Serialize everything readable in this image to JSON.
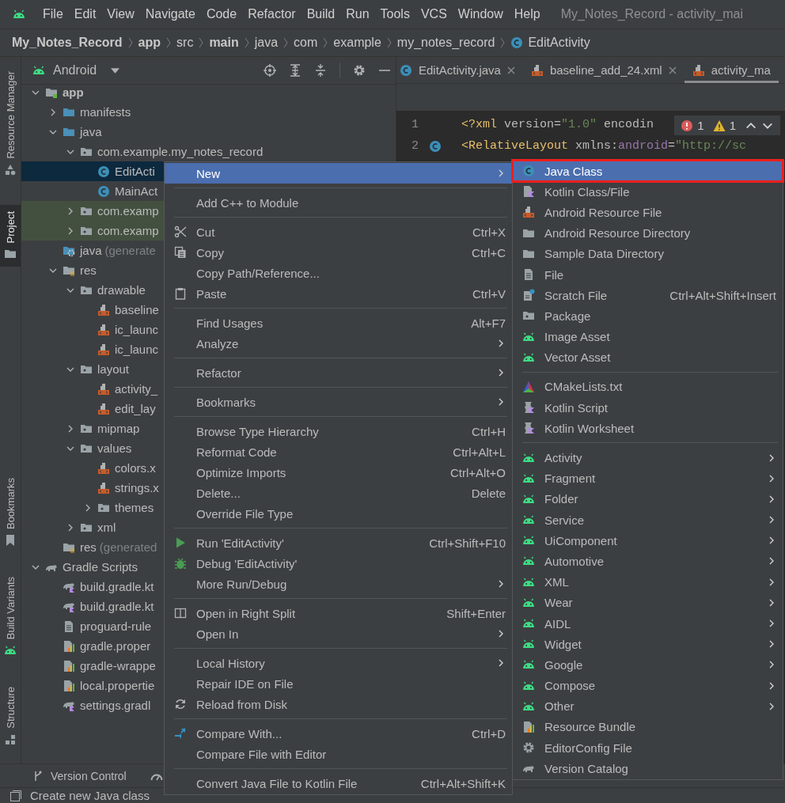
{
  "menubar": {
    "items": [
      {
        "label": "File"
      },
      {
        "label": "Edit"
      },
      {
        "label": "View"
      },
      {
        "label": "Navigate"
      },
      {
        "label": "Code"
      },
      {
        "label": "Refactor"
      },
      {
        "label": "Build"
      },
      {
        "label": "Run"
      },
      {
        "label": "Tools"
      },
      {
        "label": "VCS"
      },
      {
        "label": "Window"
      },
      {
        "label": "Help"
      }
    ],
    "title": "My_Notes_Record - activity_mai"
  },
  "breadcrumbs": [
    {
      "label": "My_Notes_Record",
      "bold": true
    },
    {
      "label": "app",
      "bold": true
    },
    {
      "label": "src",
      "bold": false
    },
    {
      "label": "main",
      "bold": true
    },
    {
      "label": "java",
      "bold": false
    },
    {
      "label": "com",
      "bold": false
    },
    {
      "label": "example",
      "bold": false
    },
    {
      "label": "my_notes_record",
      "bold": false
    },
    {
      "label": "EditActivity",
      "bold": false,
      "kind": "class"
    }
  ],
  "left_stripe": {
    "top": [
      {
        "label": "Resource Manager",
        "kind": "resources",
        "selected": false
      },
      {
        "label": "Project",
        "kind": "folder",
        "selected": true
      }
    ],
    "bottom": [
      {
        "label": "Bookmarks",
        "kind": "bookmark",
        "selected": false
      },
      {
        "label": "Build Variants",
        "kind": "android",
        "selected": false
      },
      {
        "label": "Structure",
        "kind": "structure",
        "selected": false
      }
    ]
  },
  "project": {
    "view": "Android",
    "tree": [
      {
        "label": "app",
        "kind": "module",
        "selected": false,
        "expanded": true,
        "children": [
          {
            "label": "manifests",
            "kind": "source-folder",
            "selected": false,
            "expanded": false
          },
          {
            "label": "java",
            "kind": "source-folder",
            "selected": false,
            "expanded": true,
            "children": [
              {
                "label": "com.example.my_notes_record",
                "kind": "package",
                "selected": false,
                "expanded": true,
                "children": [
                  {
                    "label": "EditActi",
                    "kind": "class",
                    "selected": true
                  },
                  {
                    "label": "MainAct",
                    "kind": "class",
                    "selected": false
                  }
                ]
              },
              {
                "label": "com.examp",
                "kind": "test-package",
                "selected": false,
                "expanded": false
              },
              {
                "label": "com.examp",
                "kind": "test-package",
                "selected": false,
                "expanded": false
              }
            ]
          },
          {
            "label": "java",
            "note": "(generate",
            "kind": "generated-folder",
            "selected": false
          },
          {
            "label": "res",
            "kind": "res-folder",
            "selected": false,
            "expanded": true,
            "children": [
              {
                "label": "drawable",
                "kind": "package",
                "selected": false,
                "expanded": true,
                "children": [
                  {
                    "label": "baseline",
                    "kind": "xml",
                    "selected": false
                  },
                  {
                    "label": "ic_launc",
                    "kind": "xml",
                    "selected": false
                  },
                  {
                    "label": "ic_launc",
                    "kind": "xml",
                    "selected": false
                  }
                ]
              },
              {
                "label": "layout",
                "kind": "package",
                "selected": false,
                "expanded": true,
                "children": [
                  {
                    "label": "activity_",
                    "kind": "xml",
                    "selected": false
                  },
                  {
                    "label": "edit_lay",
                    "kind": "xml",
                    "selected": false
                  }
                ]
              },
              {
                "label": "mipmap",
                "kind": "package",
                "selected": false,
                "expanded": false
              },
              {
                "label": "values",
                "kind": "package",
                "selected": false,
                "expanded": true,
                "children": [
                  {
                    "label": "colors.x",
                    "kind": "xml",
                    "selected": false
                  },
                  {
                    "label": "strings.x",
                    "kind": "xml",
                    "selected": false
                  },
                  {
                    "label": "themes",
                    "kind": "package",
                    "selected": false,
                    "expanded": false
                  }
                ]
              },
              {
                "label": "xml",
                "kind": "package",
                "selected": false,
                "expanded": false
              }
            ]
          },
          {
            "label": "res",
            "note": "(generated",
            "kind": "res-folder",
            "selected": false
          }
        ]
      },
      {
        "label": "Gradle Scripts",
        "kind": "gradle",
        "selected": false,
        "expanded": true,
        "children": [
          {
            "label": "build.gradle.kt",
            "kind": "gradle-kts",
            "selected": false
          },
          {
            "label": "build.gradle.kt",
            "kind": "gradle-kts",
            "selected": false
          },
          {
            "label": "proguard-rule",
            "kind": "file",
            "selected": false
          },
          {
            "label": "gradle.proper",
            "kind": "props",
            "selected": false
          },
          {
            "label": "gradle-wrappe",
            "kind": "props",
            "selected": false
          },
          {
            "label": "local.propertie",
            "kind": "props",
            "selected": false
          },
          {
            "label": "settings.gradl",
            "kind": "gradle-kts",
            "selected": false
          }
        ]
      }
    ]
  },
  "editor": {
    "tabs": [
      {
        "label": "EditActivity.java",
        "kind": "class",
        "selected": false,
        "closable": true
      },
      {
        "label": "baseline_add_24.xml",
        "kind": "xml",
        "selected": false,
        "closable": true
      },
      {
        "label": "activity_ma",
        "kind": "xml",
        "selected": true,
        "closable": false
      }
    ],
    "lines": [
      {
        "number": "1",
        "marked": false,
        "segments": [
          {
            "kind": "tag",
            "text": "<?xml"
          },
          {
            "kind": "attr",
            "text": " version="
          },
          {
            "kind": "string",
            "text": "\"1.0\""
          },
          {
            "kind": "attr",
            "text": " encodin"
          }
        ]
      },
      {
        "number": "2",
        "marked": true,
        "segments": [
          {
            "kind": "tag",
            "text": "<RelativeLayout"
          },
          {
            "kind": "attr",
            "text": " xmlns:"
          },
          {
            "kind": "namespace",
            "text": "android"
          },
          {
            "kind": "attr",
            "text": "="
          },
          {
            "kind": "string",
            "text": "\"http://sc"
          }
        ]
      }
    ],
    "inspections": {
      "errors": "1",
      "warnings": "1"
    }
  },
  "context_menu": [
    {
      "kind": "plain",
      "label": "New",
      "has_submenu": true,
      "selected": true
    },
    {
      "kind": "separator"
    },
    {
      "kind": "plain",
      "label": "Add C++ to Module",
      "has_submenu": false,
      "selected": false
    },
    {
      "kind": "separator"
    },
    {
      "kind": "cut",
      "label": "Cut",
      "shortcut": "Ctrl+X",
      "has_submenu": false,
      "selected": false
    },
    {
      "kind": "copy",
      "label": "Copy",
      "shortcut": "Ctrl+C",
      "has_submenu": false,
      "selected": false
    },
    {
      "kind": "plain",
      "label": "Copy Path/Reference...",
      "has_submenu": false,
      "selected": false
    },
    {
      "kind": "paste",
      "label": "Paste",
      "shortcut": "Ctrl+V",
      "has_submenu": false,
      "selected": false
    },
    {
      "kind": "separator"
    },
    {
      "kind": "plain",
      "label": "Find Usages",
      "shortcut": "Alt+F7",
      "has_submenu": false,
      "selected": false
    },
    {
      "kind": "plain",
      "label": "Analyze",
      "has_submenu": true,
      "selected": false
    },
    {
      "kind": "separator"
    },
    {
      "kind": "plain",
      "label": "Refactor",
      "has_submenu": true,
      "selected": false
    },
    {
      "kind": "separator"
    },
    {
      "kind": "plain",
      "label": "Bookmarks",
      "has_submenu": true,
      "selected": false
    },
    {
      "kind": "separator"
    },
    {
      "kind": "plain",
      "label": "Browse Type Hierarchy",
      "shortcut": "Ctrl+H",
      "has_submenu": false,
      "selected": false
    },
    {
      "kind": "plain",
      "label": "Reformat Code",
      "shortcut": "Ctrl+Alt+L",
      "has_submenu": false,
      "selected": false
    },
    {
      "kind": "plain",
      "label": "Optimize Imports",
      "shortcut": "Ctrl+Alt+O",
      "has_submenu": false,
      "selected": false
    },
    {
      "kind": "plain",
      "label": "Delete...",
      "shortcut": "Delete",
      "has_submenu": false,
      "selected": false
    },
    {
      "kind": "plain",
      "label": "Override File Type",
      "has_submenu": false,
      "selected": false
    },
    {
      "kind": "separator"
    },
    {
      "kind": "run",
      "label": "Run 'EditActivity'",
      "shortcut": "Ctrl+Shift+F10",
      "has_submenu": false,
      "selected": false
    },
    {
      "kind": "debug",
      "label": "Debug 'EditActivity'",
      "has_submenu": false,
      "selected": false
    },
    {
      "kind": "plain",
      "label": "More Run/Debug",
      "has_submenu": true,
      "selected": false
    },
    {
      "kind": "separator"
    },
    {
      "kind": "split",
      "label": "Open in Right Split",
      "shortcut": "Shift+Enter",
      "has_submenu": false,
      "selected": false
    },
    {
      "kind": "plain",
      "label": "Open In",
      "has_submenu": true,
      "selected": false
    },
    {
      "kind": "separator"
    },
    {
      "kind": "plain",
      "label": "Local History",
      "has_submenu": true,
      "selected": false
    },
    {
      "kind": "plain",
      "label": "Repair IDE on File",
      "has_submenu": false,
      "selected": false
    },
    {
      "kind": "reload",
      "label": "Reload from Disk",
      "has_submenu": false,
      "selected": false
    },
    {
      "kind": "separator"
    },
    {
      "kind": "compare",
      "label": "Compare With...",
      "shortcut": "Ctrl+D",
      "has_submenu": false,
      "selected": false
    },
    {
      "kind": "plain",
      "label": "Compare File with Editor",
      "has_submenu": false,
      "selected": false
    },
    {
      "kind": "separator"
    },
    {
      "kind": "plain",
      "label": "Convert Java File to Kotlin File",
      "shortcut": "Ctrl+Alt+Shift+K",
      "has_submenu": false,
      "selected": false
    }
  ],
  "new_submenu": [
    {
      "kind": "class",
      "label": "Java Class",
      "has_submenu": false,
      "selected": true,
      "outlined": true
    },
    {
      "kind": "kotlin-file",
      "label": "Kotlin Class/File",
      "has_submenu": false,
      "selected": false,
      "outlined": false
    },
    {
      "kind": "xml",
      "label": "Android Resource File",
      "has_submenu": false,
      "selected": false,
      "outlined": false
    },
    {
      "kind": "folder",
      "label": "Android Resource Directory",
      "has_submenu": false,
      "selected": false,
      "outlined": false
    },
    {
      "kind": "folder",
      "label": "Sample Data Directory",
      "has_submenu": false,
      "selected": false,
      "outlined": false
    },
    {
      "kind": "file",
      "label": "File",
      "has_submenu": false,
      "selected": false,
      "outlined": false
    },
    {
      "kind": "scratch",
      "label": "Scratch File",
      "shortcut": "Ctrl+Alt+Shift+Insert",
      "has_submenu": false,
      "selected": false,
      "outlined": false
    },
    {
      "kind": "package",
      "label": "Package",
      "has_submenu": false,
      "selected": false,
      "outlined": false
    },
    {
      "kind": "android",
      "label": "Image Asset",
      "has_submenu": false,
      "selected": false,
      "outlined": false
    },
    {
      "kind": "android",
      "label": "Vector Asset",
      "has_submenu": false,
      "selected": false,
      "outlined": false
    },
    {
      "kind": "separator"
    },
    {
      "kind": "cmake",
      "label": "CMakeLists.txt",
      "has_submenu": false,
      "selected": false,
      "outlined": false
    },
    {
      "kind": "kotlin-script",
      "label": "Kotlin Script",
      "has_submenu": false,
      "selected": false,
      "outlined": false
    },
    {
      "kind": "kotlin-script",
      "label": "Kotlin Worksheet",
      "has_submenu": false,
      "selected": false,
      "outlined": false
    },
    {
      "kind": "separator"
    },
    {
      "kind": "android",
      "label": "Activity",
      "has_submenu": true,
      "selected": false,
      "outlined": false
    },
    {
      "kind": "android",
      "label": "Fragment",
      "has_submenu": true,
      "selected": false,
      "outlined": false
    },
    {
      "kind": "android",
      "label": "Folder",
      "has_submenu": true,
      "selected": false,
      "outlined": false
    },
    {
      "kind": "android",
      "label": "Service",
      "has_submenu": true,
      "selected": false,
      "outlined": false
    },
    {
      "kind": "android",
      "label": "UiComponent",
      "has_submenu": true,
      "selected": false,
      "outlined": false
    },
    {
      "kind": "android",
      "label": "Automotive",
      "has_submenu": true,
      "selected": false,
      "outlined": false
    },
    {
      "kind": "android",
      "label": "XML",
      "has_submenu": true,
      "selected": false,
      "outlined": false
    },
    {
      "kind": "android",
      "label": "Wear",
      "has_submenu": true,
      "selected": false,
      "outlined": false
    },
    {
      "kind": "android",
      "label": "AIDL",
      "has_submenu": true,
      "selected": false,
      "outlined": false
    },
    {
      "kind": "android",
      "label": "Widget",
      "has_submenu": true,
      "selected": false,
      "outlined": false
    },
    {
      "kind": "android",
      "label": "Google",
      "has_submenu": true,
      "selected": false,
      "outlined": false
    },
    {
      "kind": "android",
      "label": "Compose",
      "has_submenu": true,
      "selected": false,
      "outlined": false
    },
    {
      "kind": "android",
      "label": "Other",
      "has_submenu": true,
      "selected": false,
      "outlined": false
    },
    {
      "kind": "props",
      "label": "Resource Bundle",
      "has_submenu": false,
      "selected": false,
      "outlined": false
    },
    {
      "kind": "gear",
      "label": "EditorConfig File",
      "has_submenu": false,
      "selected": false,
      "outlined": false
    },
    {
      "kind": "gradle",
      "label": "Version Catalog",
      "has_submenu": false,
      "selected": false,
      "outlined": false
    }
  ],
  "tool_window_bar": {
    "tabs": [
      {
        "label": "Version Control"
      }
    ]
  },
  "status_bar": {
    "message": "Create new Java class"
  }
}
